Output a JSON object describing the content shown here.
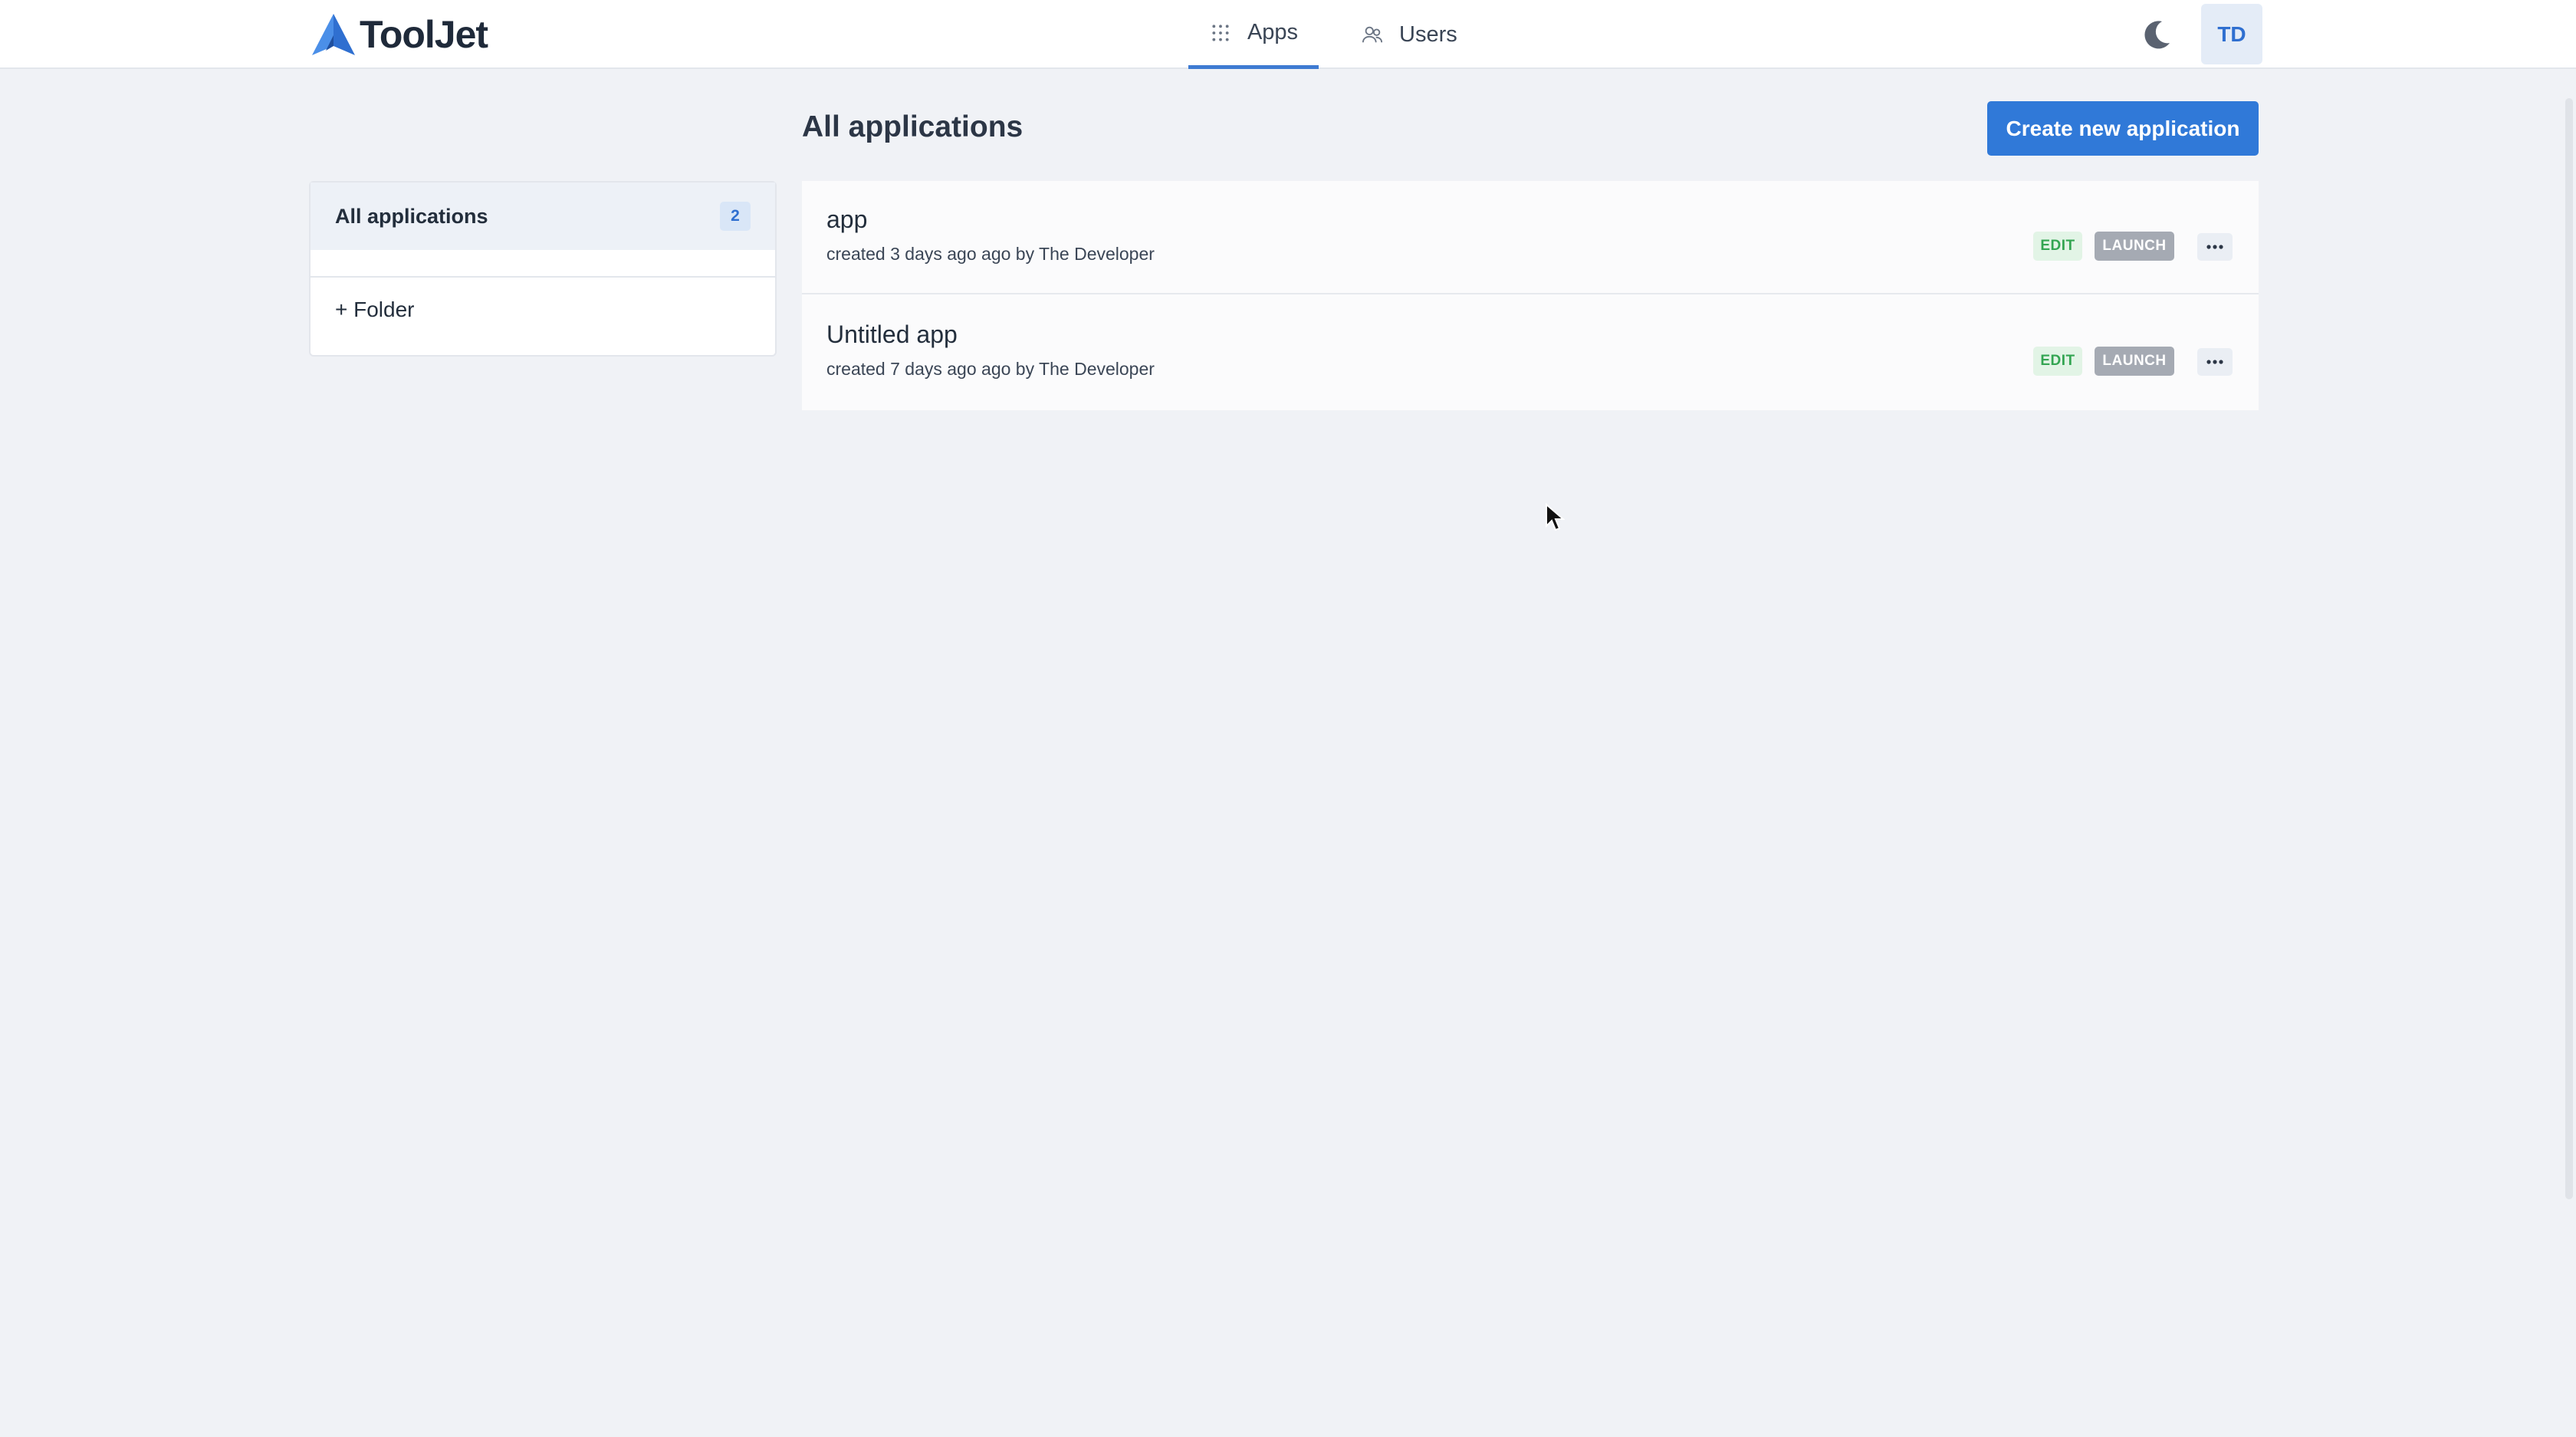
{
  "navbar": {
    "brand": "ToolJet",
    "tabs": [
      {
        "label": "Apps",
        "icon": "apps-grid-icon",
        "active": true
      },
      {
        "label": "Users",
        "icon": "users-icon",
        "active": false
      }
    ],
    "theme_toggle_icon": "moon-icon",
    "avatar_initials": "TD"
  },
  "sidebar": {
    "all_label": "All applications",
    "all_count": "2",
    "add_folder_label": "+ Folder"
  },
  "main": {
    "title": "All applications",
    "create_button_label": "Create new application",
    "apps": [
      {
        "name": "app",
        "meta": "created 3 days ago ago by The Developer",
        "edit_label": "EDIT",
        "launch_label": "LAUNCH"
      },
      {
        "name": "Untitled app",
        "meta": "created 7 days ago ago by The Developer",
        "edit_label": "EDIT",
        "launch_label": "LAUNCH"
      }
    ]
  },
  "colors": {
    "accent": "#3079d8",
    "background": "#f0f2f6",
    "edit_tag": "#33a552",
    "launch_tag": "#a5aab3"
  }
}
